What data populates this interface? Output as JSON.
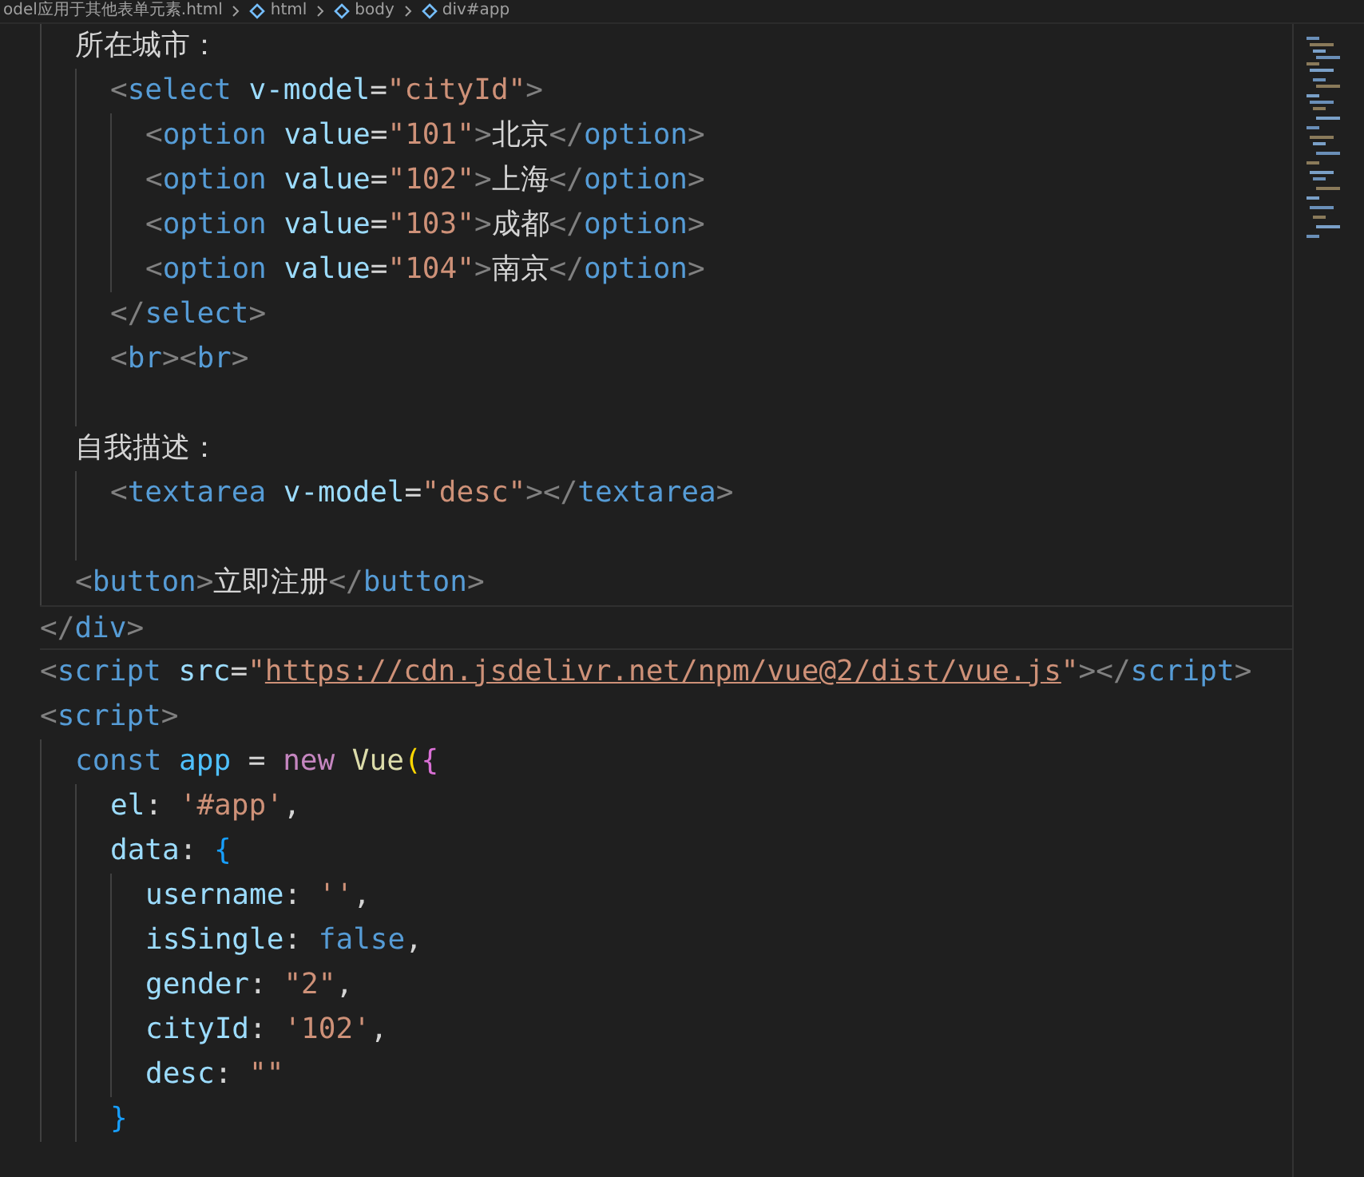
{
  "breadcrumb": [
    {
      "label": "odel应用于其他表单元素.html",
      "kind": "file"
    },
    {
      "label": "html",
      "kind": "element"
    },
    {
      "label": "body",
      "kind": "element"
    },
    {
      "label": "div#app",
      "kind": "element"
    }
  ],
  "editor": {
    "lines": [
      {
        "current": false,
        "tokens": [
          {
            "kind": "text",
            "text": "  所在城市："
          }
        ]
      },
      {
        "current": false,
        "tokens": [
          {
            "kind": "punct",
            "text": "    <"
          },
          {
            "kind": "tag",
            "text": "select"
          },
          {
            "kind": "attr",
            "text": " v-model"
          },
          {
            "kind": "text",
            "text": "="
          },
          {
            "kind": "string",
            "text": "\"cityId\""
          },
          {
            "kind": "punct",
            "text": ">"
          }
        ]
      },
      {
        "current": false,
        "tokens": [
          {
            "kind": "punct",
            "text": "      <"
          },
          {
            "kind": "tag",
            "text": "option"
          },
          {
            "kind": "attr",
            "text": " value"
          },
          {
            "kind": "text",
            "text": "="
          },
          {
            "kind": "string",
            "text": "\"101\""
          },
          {
            "kind": "punct",
            "text": ">"
          },
          {
            "kind": "text",
            "text": "北京"
          },
          {
            "kind": "punct",
            "text": "</"
          },
          {
            "kind": "tag",
            "text": "option"
          },
          {
            "kind": "punct",
            "text": ">"
          }
        ]
      },
      {
        "current": false,
        "tokens": [
          {
            "kind": "punct",
            "text": "      <"
          },
          {
            "kind": "tag",
            "text": "option"
          },
          {
            "kind": "attr",
            "text": " value"
          },
          {
            "kind": "text",
            "text": "="
          },
          {
            "kind": "string",
            "text": "\"102\""
          },
          {
            "kind": "punct",
            "text": ">"
          },
          {
            "kind": "text",
            "text": "上海"
          },
          {
            "kind": "punct",
            "text": "</"
          },
          {
            "kind": "tag",
            "text": "option"
          },
          {
            "kind": "punct",
            "text": ">"
          }
        ]
      },
      {
        "current": false,
        "tokens": [
          {
            "kind": "punct",
            "text": "      <"
          },
          {
            "kind": "tag",
            "text": "option"
          },
          {
            "kind": "attr",
            "text": " value"
          },
          {
            "kind": "text",
            "text": "="
          },
          {
            "kind": "string",
            "text": "\"103\""
          },
          {
            "kind": "punct",
            "text": ">"
          },
          {
            "kind": "text",
            "text": "成都"
          },
          {
            "kind": "punct",
            "text": "</"
          },
          {
            "kind": "tag",
            "text": "option"
          },
          {
            "kind": "punct",
            "text": ">"
          }
        ]
      },
      {
        "current": false,
        "tokens": [
          {
            "kind": "punct",
            "text": "      <"
          },
          {
            "kind": "tag",
            "text": "option"
          },
          {
            "kind": "attr",
            "text": " value"
          },
          {
            "kind": "text",
            "text": "="
          },
          {
            "kind": "string",
            "text": "\"104\""
          },
          {
            "kind": "punct",
            "text": ">"
          },
          {
            "kind": "text",
            "text": "南京"
          },
          {
            "kind": "punct",
            "text": "</"
          },
          {
            "kind": "tag",
            "text": "option"
          },
          {
            "kind": "punct",
            "text": ">"
          }
        ]
      },
      {
        "current": false,
        "tokens": [
          {
            "kind": "punct",
            "text": "    </"
          },
          {
            "kind": "tag",
            "text": "select"
          },
          {
            "kind": "punct",
            "text": ">"
          }
        ]
      },
      {
        "current": false,
        "tokens": [
          {
            "kind": "punct",
            "text": "    <"
          },
          {
            "kind": "tag",
            "text": "br"
          },
          {
            "kind": "punct",
            "text": "><"
          },
          {
            "kind": "tag",
            "text": "br"
          },
          {
            "kind": "punct",
            "text": ">"
          }
        ]
      },
      {
        "current": false
      },
      {
        "current": false,
        "tokens": [
          {
            "kind": "text",
            "text": "  自我描述："
          }
        ]
      },
      {
        "current": false,
        "tokens": [
          {
            "kind": "punct",
            "text": "    <"
          },
          {
            "kind": "tag",
            "text": "textarea"
          },
          {
            "kind": "attr",
            "text": " v-model"
          },
          {
            "kind": "text",
            "text": "="
          },
          {
            "kind": "string",
            "text": "\"desc\""
          },
          {
            "kind": "punct",
            "text": "></"
          },
          {
            "kind": "tag",
            "text": "textarea"
          },
          {
            "kind": "punct",
            "text": ">"
          }
        ]
      },
      {
        "current": false
      },
      {
        "current": false,
        "tokens": [
          {
            "kind": "punct",
            "text": "  <"
          },
          {
            "kind": "tag",
            "text": "button"
          },
          {
            "kind": "punct",
            "text": ">"
          },
          {
            "kind": "text",
            "text": "立即注册"
          },
          {
            "kind": "punct",
            "text": "</"
          },
          {
            "kind": "tag",
            "text": "button"
          },
          {
            "kind": "punct",
            "text": ">"
          }
        ]
      },
      {
        "current": true,
        "tokens": [
          {
            "kind": "punct",
            "text": "</"
          },
          {
            "kind": "tag",
            "text": "div"
          },
          {
            "kind": "punct",
            "text": ">"
          }
        ]
      },
      {
        "current": false,
        "tokens": [
          {
            "kind": "punct",
            "text": "<"
          },
          {
            "kind": "tag",
            "text": "script"
          },
          {
            "kind": "attr",
            "text": " src"
          },
          {
            "kind": "text",
            "text": "="
          },
          {
            "kind": "string",
            "text": "\""
          },
          {
            "kind": "link",
            "text": "https://cdn.jsdelivr.net/npm/vue@2/dist/vue.js"
          },
          {
            "kind": "string",
            "text": "\""
          },
          {
            "kind": "punct",
            "text": "></"
          },
          {
            "kind": "tag",
            "text": "script"
          },
          {
            "kind": "punct",
            "text": ">"
          }
        ]
      },
      {
        "current": false,
        "tokens": [
          {
            "kind": "punct",
            "text": "<"
          },
          {
            "kind": "tag",
            "text": "script"
          },
          {
            "kind": "punct",
            "text": ">"
          }
        ]
      },
      {
        "current": false,
        "tokens": [
          {
            "kind": "keyword",
            "text": "  const"
          },
          {
            "kind": "var",
            "text": " app"
          },
          {
            "kind": "text",
            "text": " = "
          },
          {
            "kind": "control",
            "text": "new"
          },
          {
            "kind": "func",
            "text": " Vue"
          },
          {
            "kind": "bracket1",
            "text": "("
          },
          {
            "kind": "bracket2",
            "text": "{"
          }
        ]
      },
      {
        "current": false,
        "tokens": [
          {
            "kind": "prop",
            "text": "    el"
          },
          {
            "kind": "text",
            "text": ": "
          },
          {
            "kind": "string",
            "text": "'#app'"
          },
          {
            "kind": "text",
            "text": ","
          }
        ]
      },
      {
        "current": false,
        "tokens": [
          {
            "kind": "prop",
            "text": "    data"
          },
          {
            "kind": "text",
            "text": ": "
          },
          {
            "kind": "bracket3",
            "text": "{"
          }
        ]
      },
      {
        "current": false,
        "tokens": [
          {
            "kind": "prop",
            "text": "      username"
          },
          {
            "kind": "text",
            "text": ": "
          },
          {
            "kind": "string",
            "text": "''"
          },
          {
            "kind": "text",
            "text": ","
          }
        ]
      },
      {
        "current": false,
        "tokens": [
          {
            "kind": "prop",
            "text": "      isSingle"
          },
          {
            "kind": "text",
            "text": ": "
          },
          {
            "kind": "keyword",
            "text": "false"
          },
          {
            "kind": "text",
            "text": ","
          }
        ]
      },
      {
        "current": false,
        "tokens": [
          {
            "kind": "prop",
            "text": "      gender"
          },
          {
            "kind": "text",
            "text": ": "
          },
          {
            "kind": "string",
            "text": "\"2\""
          },
          {
            "kind": "text",
            "text": ","
          }
        ]
      },
      {
        "current": false,
        "tokens": [
          {
            "kind": "prop",
            "text": "      cityId"
          },
          {
            "kind": "text",
            "text": ": "
          },
          {
            "kind": "string",
            "text": "'102'"
          },
          {
            "kind": "text",
            "text": ","
          }
        ]
      },
      {
        "current": false,
        "tokens": [
          {
            "kind": "prop",
            "text": "      desc"
          },
          {
            "kind": "text",
            "text": ": "
          },
          {
            "kind": "string",
            "text": "\"\""
          }
        ]
      },
      {
        "current": false,
        "tokens": [
          {
            "kind": "bracket3",
            "text": "    }"
          }
        ]
      }
    ]
  }
}
